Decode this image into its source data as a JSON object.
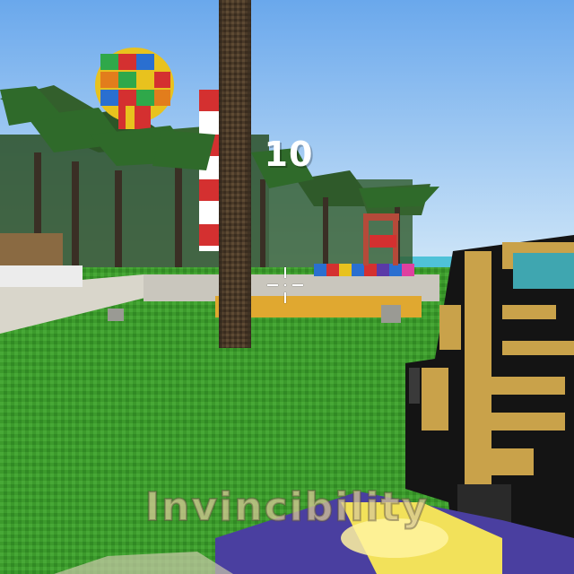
{
  "hud": {
    "counter": "10",
    "powerup_label": "Invincibility"
  },
  "colors": {
    "sky": "#7fb6f0",
    "grass": "#3f9b2e",
    "weapon_gold": "#c9a24a",
    "weapon_black": "#141414",
    "weapon_teal": "#3fa6b0"
  },
  "icons": {
    "crosshair": "crosshair-icon"
  }
}
